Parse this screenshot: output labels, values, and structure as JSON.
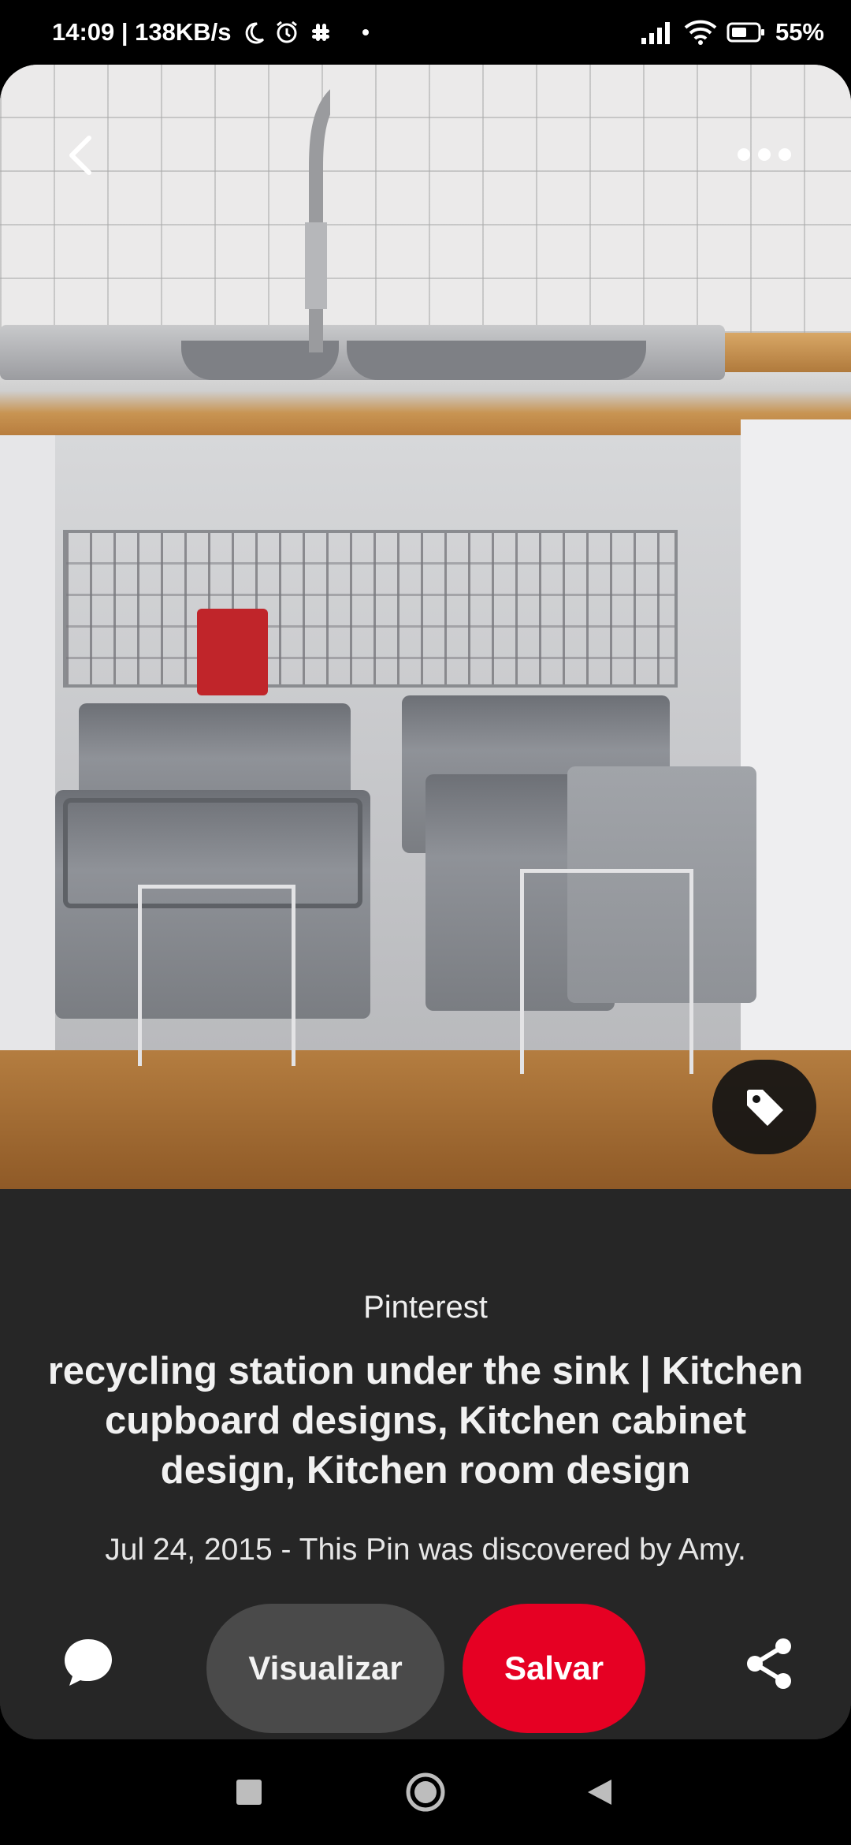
{
  "status_bar": {
    "time_speed": "14:09 | 138KB/s",
    "battery": "55%",
    "icons": [
      "moon-icon",
      "alarm-icon",
      "slack-icon",
      "notification-dot",
      "signal-icon",
      "wifi-icon",
      "battery-icon"
    ]
  },
  "pin": {
    "image_alt": "Under-sink cabinet with pull-out recycling bins",
    "top_icons": [
      "back-icon",
      "more-icon"
    ],
    "tag_icon": "tag-icon"
  },
  "info": {
    "source": "Pinterest",
    "title": "recycling station under the sink | Kitchen cupboard designs, Kitchen cabinet design, Kitchen room design",
    "description": "Jul 24, 2015 - This Pin was discovered by Amy."
  },
  "actions": {
    "visit_label": "Visualizar",
    "save_label": "Salvar",
    "comment_icon": "comment-icon",
    "share_icon": "share-icon",
    "save_color": "#e60023"
  },
  "nav_bar": {
    "items": [
      "recents-icon",
      "home-icon",
      "back-icon"
    ]
  }
}
